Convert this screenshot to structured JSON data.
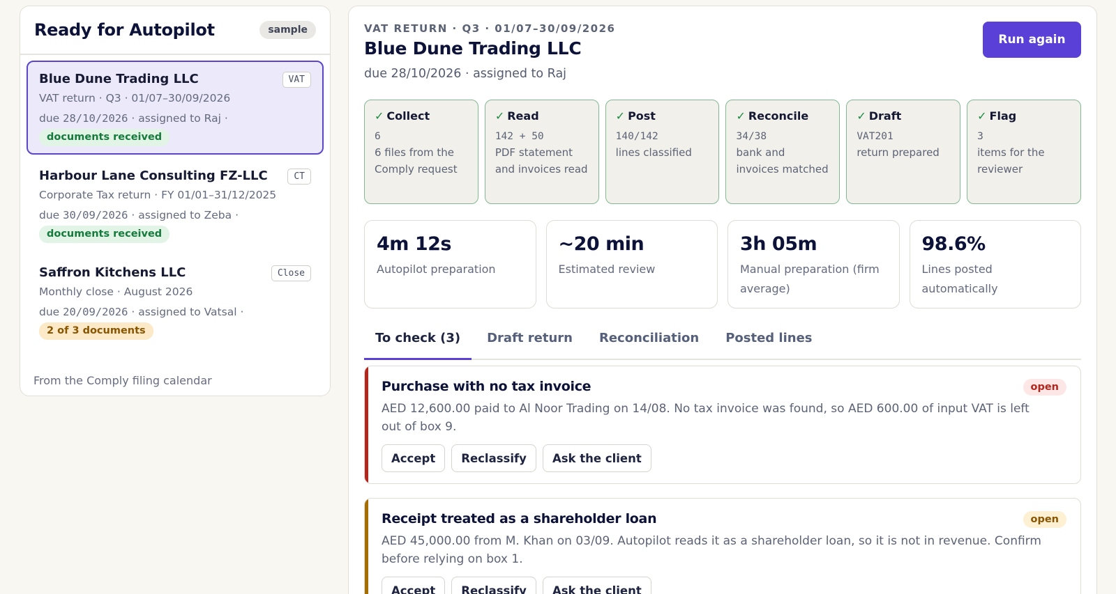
{
  "sidebar": {
    "title": "Ready for Autopilot",
    "sample_badge": "sample",
    "cases": [
      {
        "name": "Blue Dune Trading LLC",
        "tag": "VAT",
        "line1": "VAT return · Q3 · 01/07–30/09/2026",
        "due_date": "28/10/2026",
        "due_prefix": "due ",
        "assigned": " · assigned to Raj ·",
        "status": "documents received",
        "status_kind": "green",
        "selected": true
      },
      {
        "name": "Harbour Lane Consulting FZ-LLC",
        "tag": "CT",
        "line1": "Corporate Tax return · FY 01/01–31/12/2025",
        "due_date": "30/09/2026",
        "due_prefix": "due ",
        "assigned": " · assigned to Zeba ·",
        "status": "documents received",
        "status_kind": "green",
        "selected": false
      },
      {
        "name": "Saffron Kitchens LLC",
        "tag": "Close",
        "line1": "Monthly close · August 2026",
        "due_date": "20/09/2026",
        "due_prefix": "due ",
        "assigned": " · assigned to Vatsal ·",
        "status": "2 of 3 documents",
        "status_kind": "amber",
        "selected": false
      }
    ],
    "footer": "From the Comply filing calendar"
  },
  "main": {
    "eyebrow": "VAT RETURN · Q3 · 01/07–30/09/2026",
    "title": "Blue Dune Trading LLC",
    "subtitle": "due 28/10/2026 · assigned to Raj",
    "run_button": "Run again",
    "check_glyph": "✓",
    "steps": [
      {
        "title": "Collect",
        "value": "6",
        "desc": "6 files from the Comply request"
      },
      {
        "title": "Read",
        "value": "142 + 50",
        "desc": "PDF statement and invoices read"
      },
      {
        "title": "Post",
        "value": "140/142",
        "desc": "lines classified"
      },
      {
        "title": "Reconcile",
        "value": "34/38",
        "desc": "bank and invoices matched"
      },
      {
        "title": "Draft",
        "value": "VAT201",
        "desc": "return prepared"
      },
      {
        "title": "Flag",
        "value": "3",
        "desc": "items for the reviewer"
      }
    ],
    "metrics": [
      {
        "value": "4m 12s",
        "label": "Autopilot preparation"
      },
      {
        "value": "~20 min",
        "label": "Estimated review"
      },
      {
        "value": "3h 05m",
        "label": "Manual preparation (firm average)"
      },
      {
        "value": "98.6%",
        "label": "Lines posted automatically"
      }
    ],
    "tabs": [
      {
        "label": "To check (3)",
        "active": true
      },
      {
        "label": "Draft return",
        "active": false
      },
      {
        "label": "Reconciliation",
        "active": false
      },
      {
        "label": "Posted lines",
        "active": false
      }
    ],
    "issues": [
      {
        "title": "Purchase with no tax invoice",
        "status": "open",
        "severity": "red",
        "text": "AED 12,600.00 paid to Al Noor Trading on 14/08. No tax invoice was found, so AED 600.00 of input VAT is left out of box 9.",
        "actions": [
          "Accept",
          "Reclassify",
          "Ask the client"
        ]
      },
      {
        "title": "Receipt treated as a shareholder loan",
        "status": "open",
        "severity": "amber",
        "text": "AED 45,000.00 from M. Khan on 03/09. Autopilot reads it as a shareholder loan, so it is not in revenue. Confirm before relying on box 1.",
        "actions": [
          "Accept",
          "Reclassify",
          "Ask the client"
        ]
      }
    ]
  },
  "colors": {
    "accent": "#5a40d6",
    "selected_bg": "#ece9fb",
    "step_border": "#82b992",
    "severity_red": "#b3261e",
    "severity_amber": "#a56d00"
  }
}
